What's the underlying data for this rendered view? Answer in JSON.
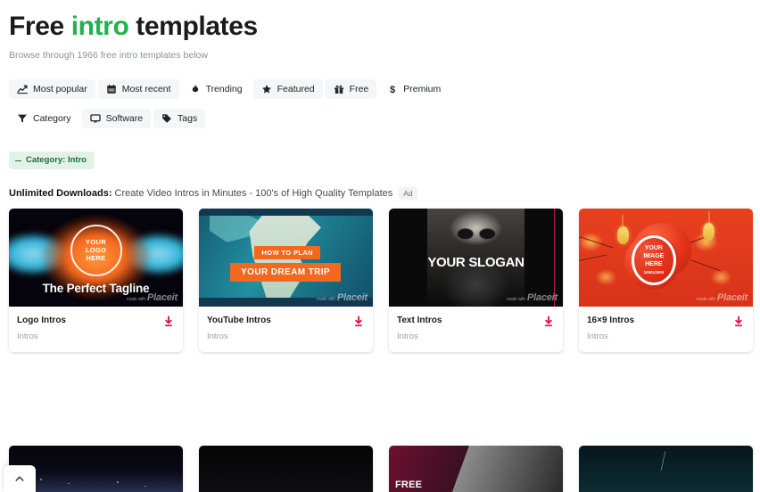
{
  "header": {
    "title_part1": "Free ",
    "title_accent": "intro",
    "title_part2": " templates",
    "subtitle": "Browse through 1966 free intro templates below"
  },
  "filters": {
    "row1": [
      {
        "label": "Most popular",
        "icon": "chart-line-icon",
        "active": true
      },
      {
        "label": "Most recent",
        "icon": "calendar-icon",
        "active": true
      },
      {
        "label": "Trending",
        "icon": "flame-icon",
        "active": false
      },
      {
        "label": "Featured",
        "icon": "star-icon",
        "active": true
      },
      {
        "label": "Free",
        "icon": "gift-icon",
        "active": true
      },
      {
        "label": "Premium",
        "icon": "dollar-icon",
        "active": false
      }
    ],
    "row2": [
      {
        "label": "Category",
        "icon": "funnel-icon",
        "active": false
      },
      {
        "label": "Software",
        "icon": "monitor-icon",
        "active": true
      },
      {
        "label": "Tags",
        "icon": "tag-icon",
        "active": true
      }
    ]
  },
  "active_tag": {
    "label": "Category: Intro",
    "color": "#e3f1e8",
    "text_color": "#1d6b43"
  },
  "ad": {
    "headline": "Unlimited Downloads:",
    "body": " Create Video Intros in Minutes - 100's of High Quality Templates",
    "badge": "Ad"
  },
  "cards": [
    {
      "title": "Logo Intros",
      "subtitle": "Intros",
      "art": "logo-smoke-reveal",
      "art_text": {
        "ring": "YOUR\nLOGO\nHERE",
        "tagline": "The Perfect Tagline"
      },
      "watermark": "Placeit",
      "watermark_prefix": "made with"
    },
    {
      "title": "YouTube Intros",
      "subtitle": "Intros",
      "art": "travel-map",
      "art_text": {
        "banner1": "HOW TO PLAN",
        "banner2": "YOUR DREAM TRIP"
      },
      "watermark": "Placeit",
      "watermark_prefix": "made with"
    },
    {
      "title": "Text Intros",
      "subtitle": "Intros",
      "art": "bw-portrait",
      "art_text": {
        "slogan": "YOUR SLOGAN"
      },
      "watermark": "Placeit",
      "watermark_prefix": "made with"
    },
    {
      "title": "16×9 Intros",
      "subtitle": "Intros",
      "art": "chinese-new-year",
      "art_text": {
        "ring": "YOUR\nIMAGE\nHERE",
        "ring_sub": "1000x1000"
      },
      "watermark": "Placeit",
      "watermark_prefix": "made with"
    }
  ],
  "download_icon": {
    "name": "download-icon",
    "color": "#d81b4a"
  },
  "bottom_row": [
    {
      "art": "night-sky"
    },
    {
      "art": "dark-black"
    },
    {
      "art": "free-badge-portrait",
      "badge": "FREE"
    },
    {
      "art": "dark-teal"
    }
  ],
  "scroll_top": {
    "icon": "chevron-up-icon",
    "label": "Scroll to top"
  }
}
